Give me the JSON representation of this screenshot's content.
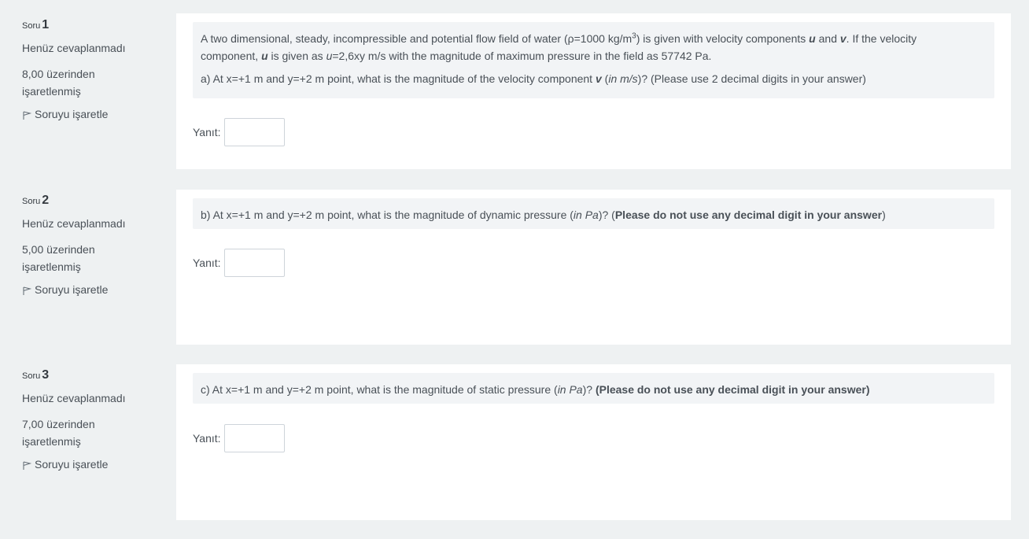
{
  "questions": [
    {
      "qno_prefix": "Soru",
      "qno": "1",
      "state": "Henüz cevaplanmadı",
      "grade_line1": "8,00 üzerinden",
      "grade_line2": "işaretlenmiş",
      "flag_label": "Soruyu işaretle",
      "text": {
        "p1_a": "A two dimensional, steady, incompressible and potential flow field of water (ρ=1000 kg/m",
        "p1_sup": "3",
        "p1_b": ") is given with velocity components ",
        "p1_u": "u",
        "p1_and": " and ",
        "p1_v": "v",
        "p1_c": ". If the velocity",
        "p1_d": "component, ",
        "p1_u2": "u",
        "p1_e": " is given as ",
        "p1_u3": "u",
        "p1_f": "=2,6xy  m/s  with the magnitude of maximum pressure in the field as 57742 Pa.",
        "p2_a": "a) At x=+1 m and y=+2 m point, what is the magnitude of the velocity component ",
        "p2_v": "v",
        "p2_b": " (",
        "p2_unit": "in m/s",
        "p2_c": ")? (Please use 2 decimal digits in your answer)"
      },
      "answer_label": "Yanıt:",
      "answer_value": ""
    },
    {
      "qno_prefix": "Soru",
      "qno": "2",
      "state": "Henüz cevaplanmadı",
      "grade_line1": "5,00 üzerinden",
      "grade_line2": "işaretlenmiş",
      "flag_label": "Soruyu işaretle",
      "text": {
        "a": "b) At x=+1 m and y=+2 m point, what is the magnitude of dynamic pressure  (",
        "unit": "in Pa",
        "b": ")? (",
        "bold": "Please do not use any decimal digit in your answer",
        "c": ")"
      },
      "answer_label": "Yanıt:",
      "answer_value": ""
    },
    {
      "qno_prefix": "Soru",
      "qno": "3",
      "state": "Henüz cevaplanmadı",
      "grade_line1": "7,00 üzerinden",
      "grade_line2": "işaretlenmiş",
      "flag_label": "Soruyu işaretle",
      "text": {
        "a": "c) At x=+1 m and y=+2 m point, what is the magnitude of static pressure (",
        "unit": "in Pa",
        "b": ")? ",
        "bold": "(Please do not use any decimal digit in your answer)"
      },
      "answer_label": "Yanıt:",
      "answer_value": ""
    }
  ],
  "icons": {
    "flag": "flag-icon"
  },
  "colors": {
    "page_bg": "#eef1f2",
    "card_bg": "#ffffff",
    "qtext_bg": "#f2f4f6",
    "text": "#495057"
  }
}
